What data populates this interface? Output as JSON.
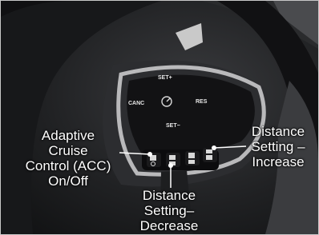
{
  "controls": {
    "set_plus": "SET+",
    "set_minus": "SET−",
    "canc": "CANC",
    "res": "RES"
  },
  "labels": {
    "acc": [
      "Adaptive",
      "Cruise",
      "Control (ACC)",
      "On/Off"
    ],
    "distance_increase": [
      "Distance",
      "Setting –",
      "Increase"
    ],
    "distance_decrease": [
      "Distance",
      "Setting–",
      "Decrease"
    ]
  }
}
